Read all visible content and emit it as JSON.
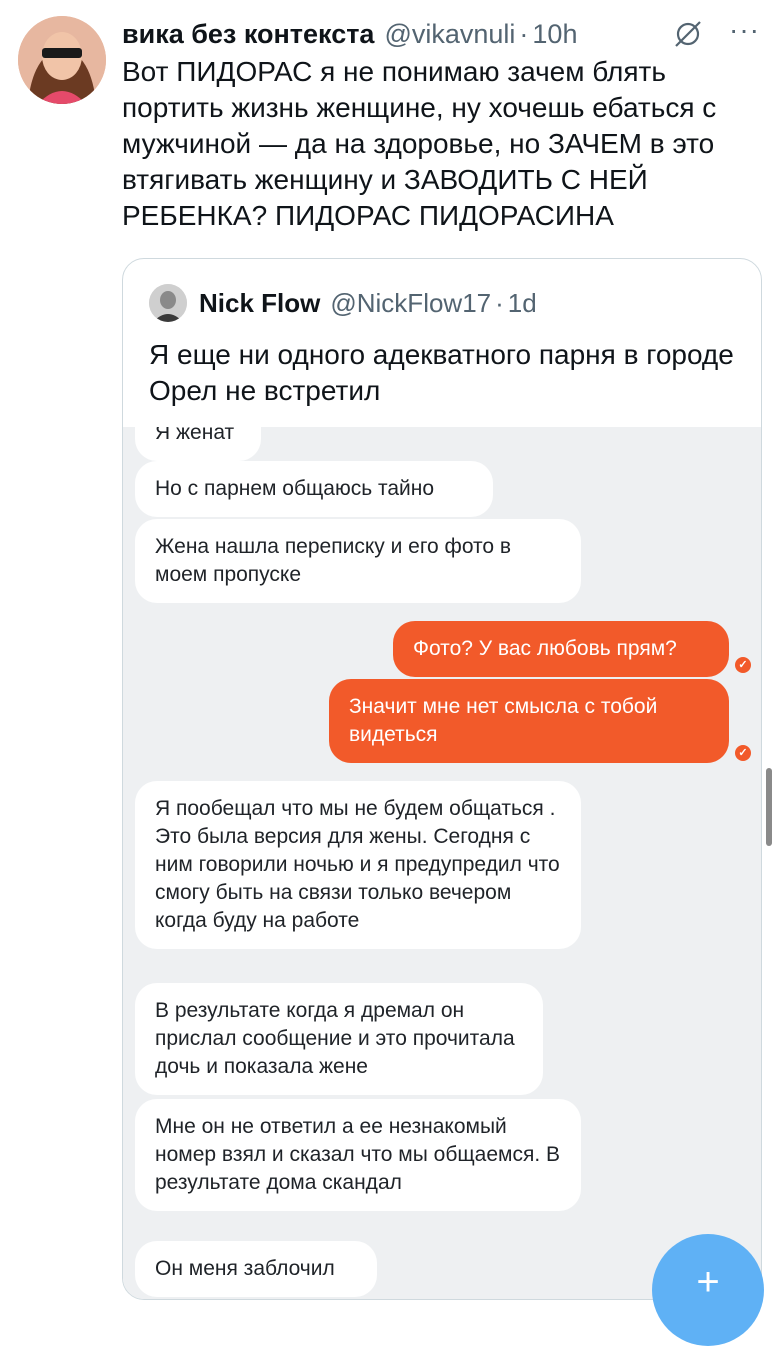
{
  "post": {
    "author_name": "вика без контекста",
    "handle": "@vikavnuli",
    "separator": "·",
    "time": "10h",
    "text": "Вот ПИДОРАС я не понимаю зачем блять портить жизнь женщине, ну хочешь ебаться с мужчиной — да на здоровье, но ЗАЧЕМ в это втягивать женщину и ЗАВОДИТЬ С НЕЙ РЕБЕНКА? ПИДОРАС ПИДОРАСИНА",
    "more_label": "···"
  },
  "quote": {
    "author_name": "Nick Flow",
    "handle": "@NickFlow17",
    "separator": "·",
    "time": "1d",
    "text": "Я еще ни одного адекватного парня в городе Орел не встретил"
  },
  "chat": {
    "messages": [
      {
        "side": "in",
        "text": "Я женат"
      },
      {
        "side": "in",
        "text": "Но с парнем общаюсь тайно"
      },
      {
        "side": "in",
        "text": "Жена нашла переписку и его фото в моем пропуске"
      },
      {
        "side": "out",
        "text": "Фото? У вас любовь прям?"
      },
      {
        "side": "out",
        "text": "Значит мне нет смысла с тобой видеться"
      },
      {
        "side": "in",
        "text": "Я пообещал что мы не будем общаться . Это была версия для жены. Сегодня с ним говорили ночью и я предупредил что смогу быть на связи только вечером когда буду на работе"
      },
      {
        "side": "in",
        "text": "В результате когда я дремал он прислал сообщение и это прочитала дочь и показала жене"
      },
      {
        "side": "in",
        "text": "Мне он не ответил а ее незнакомый номер взял и сказал что мы общаемся. В результате дома скандал"
      },
      {
        "side": "in",
        "text": "Он меня заблочил"
      }
    ],
    "read_mark": "✓"
  },
  "fab": {
    "label": "+"
  },
  "colors": {
    "outgoing": "#f25a2a",
    "incoming": "#ffffff",
    "chat_bg": "#eef0f2",
    "fab": "#5fb1f5"
  },
  "icons": {
    "grok": "grok-icon",
    "more": "more-icon"
  }
}
